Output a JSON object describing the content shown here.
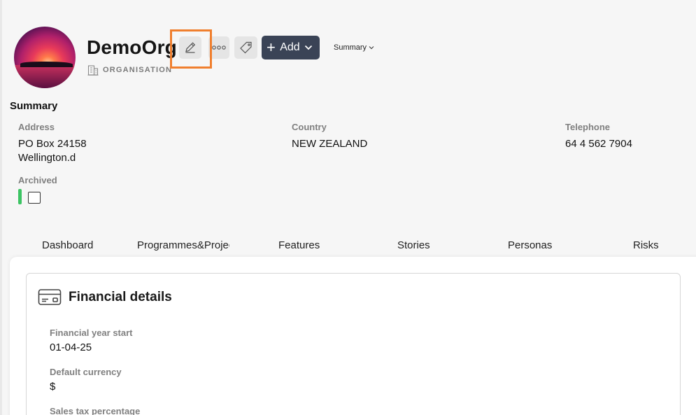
{
  "header": {
    "org_name": "DemoOrg",
    "org_type": "ORGANISATION",
    "add_label": "Add",
    "summary_dropdown": "Summary"
  },
  "summary": {
    "title": "Summary",
    "fields": {
      "address_label": "Address",
      "address_line1": "PO Box 24158",
      "address_line2": "Wellington.d",
      "country_label": "Country",
      "country_value": "NEW ZEALAND",
      "telephone_label": "Telephone",
      "telephone_value": "64 4 562 7904",
      "archived_label": "Archived",
      "archived_checked": false
    }
  },
  "tabs": [
    "Dashboard",
    "Programmes&Projects",
    "Features",
    "Stories",
    "Personas",
    "Risks"
  ],
  "financial": {
    "title": "Financial details",
    "fields": [
      {
        "label": "Financial year start",
        "value": "01-04-25"
      },
      {
        "label": "Default currency",
        "value": "$"
      },
      {
        "label": "Sales tax percentage",
        "value": ""
      }
    ]
  },
  "colors": {
    "accent_dark": "#3a4356",
    "highlight": "#f07f2e",
    "archived_indicator": "#3cc463"
  },
  "icons": {
    "edit": "pencil-icon",
    "more": "ellipsis-icon",
    "tag": "tag-icon",
    "type": "building-icon",
    "card": "credit-card-icon"
  }
}
